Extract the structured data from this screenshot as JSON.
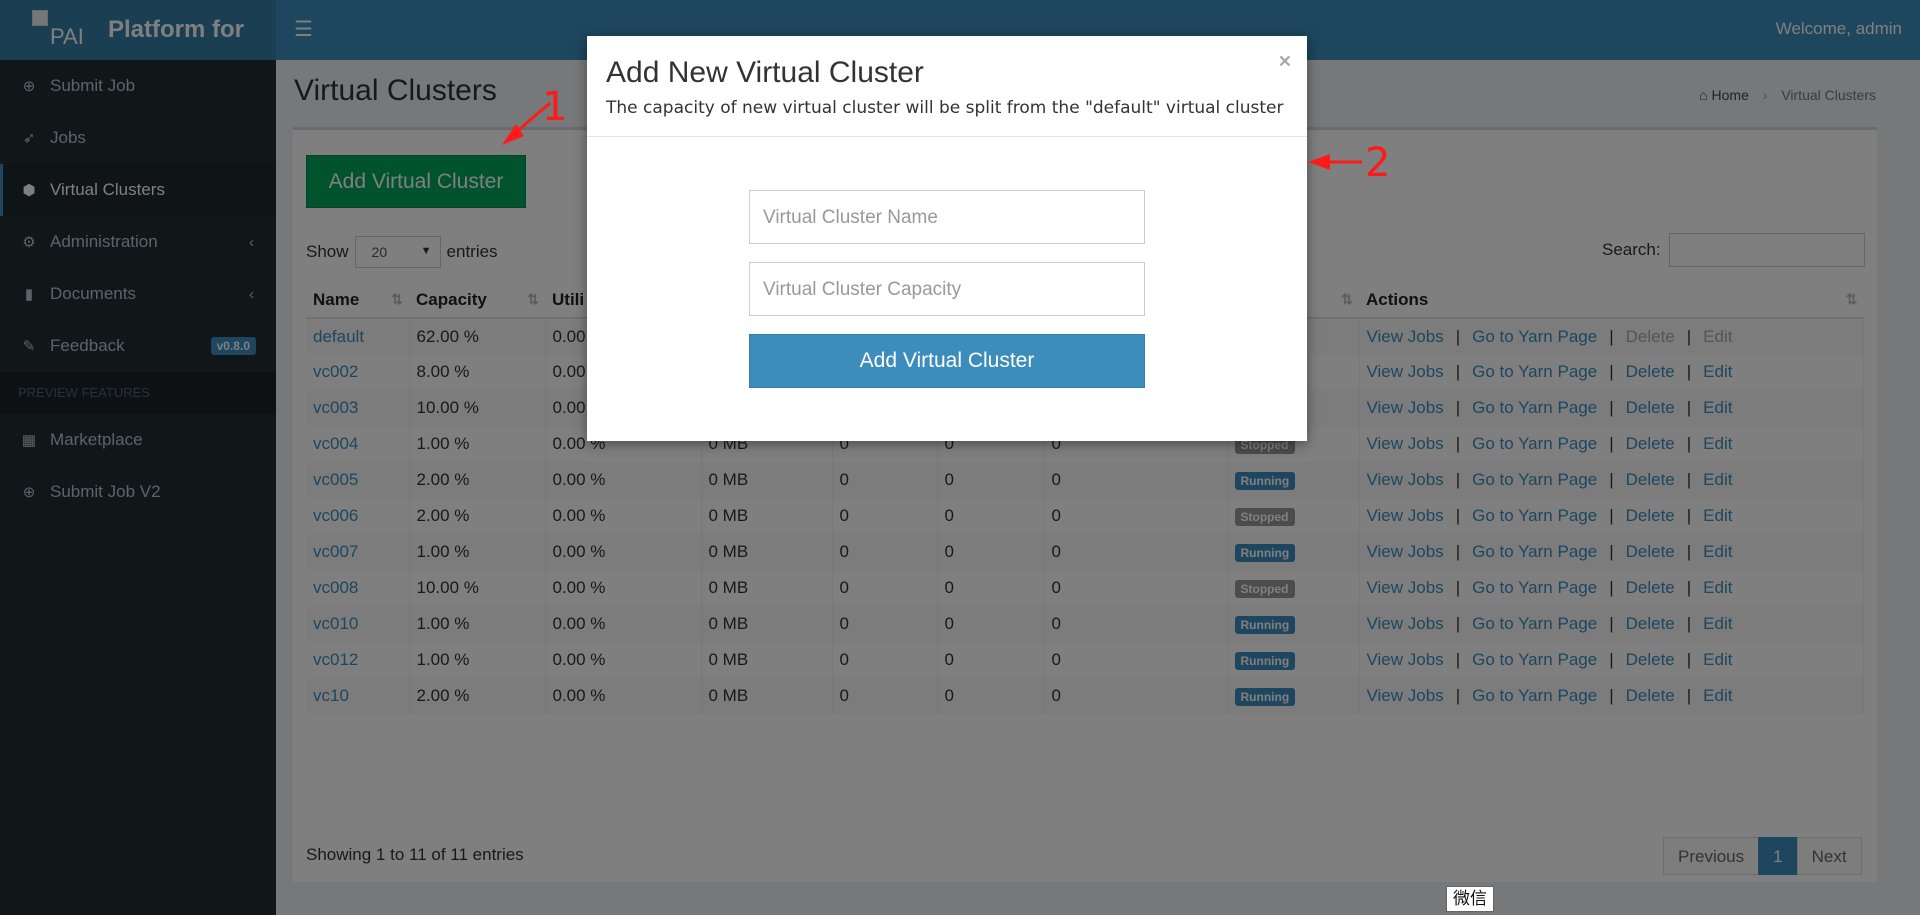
{
  "app": {
    "logo_alt": "PAI",
    "logo_title": "Platform for",
    "welcome": "Welcome, admin"
  },
  "sidebar": {
    "items": [
      {
        "label": "Submit Job",
        "icon": "plus-circle-icon"
      },
      {
        "label": "Jobs",
        "icon": "rocket-icon"
      },
      {
        "label": "Virtual Clusters",
        "icon": "cubes-icon",
        "active": true
      },
      {
        "label": "Administration",
        "icon": "gears-icon"
      },
      {
        "label": "Documents",
        "icon": "book-icon"
      },
      {
        "label": "Feedback",
        "icon": "comments-icon",
        "badge": "v0.8.0"
      }
    ],
    "section_header": "PREVIEW FEATURES",
    "preview_items": [
      {
        "label": "Marketplace",
        "icon": "grid-icon"
      },
      {
        "label": "Submit Job V2",
        "icon": "plus-circle-icon"
      }
    ]
  },
  "page": {
    "title": "Virtual Clusters",
    "breadcrumb": {
      "home": "Home",
      "current": "Virtual Clusters"
    }
  },
  "toolbar": {
    "add_label": "Add Virtual Cluster"
  },
  "table_controls": {
    "show_label": "Show",
    "entries_value": "20",
    "entries_label": "entries",
    "search_label": "Search:"
  },
  "table": {
    "headers": {
      "name": "Name",
      "capacity": "Capacity",
      "utilization": "Utili",
      "actions": "Actions"
    },
    "action_labels": {
      "view_jobs": "View Jobs",
      "yarn": "Go to Yarn Page",
      "delete": "Delete",
      "edit": "Edit"
    },
    "rows": [
      {
        "name": "default",
        "capacity": "62.00 %",
        "used": "0.00",
        "mem": "",
        "c1": "",
        "c2": "",
        "c3": "",
        "status": "",
        "delete_disabled": true
      },
      {
        "name": "vc002",
        "capacity": "8.00 %",
        "used": "0.00",
        "mem": "",
        "c1": "",
        "c2": "",
        "c3": "",
        "status": ""
      },
      {
        "name": "vc003",
        "capacity": "10.00 %",
        "used": "0.00",
        "mem": "",
        "c1": "",
        "c2": "",
        "c3": "",
        "status": ""
      },
      {
        "name": "vc004",
        "capacity": "1.00 %",
        "used": "0.00 %",
        "mem": "0 MB",
        "c1": "0",
        "c2": "0",
        "c3": "0",
        "status": "Stopped"
      },
      {
        "name": "vc005",
        "capacity": "2.00 %",
        "used": "0.00 %",
        "mem": "0 MB",
        "c1": "0",
        "c2": "0",
        "c3": "0",
        "status": "Running"
      },
      {
        "name": "vc006",
        "capacity": "2.00 %",
        "used": "0.00 %",
        "mem": "0 MB",
        "c1": "0",
        "c2": "0",
        "c3": "0",
        "status": "Stopped"
      },
      {
        "name": "vc007",
        "capacity": "1.00 %",
        "used": "0.00 %",
        "mem": "0 MB",
        "c1": "0",
        "c2": "0",
        "c3": "0",
        "status": "Running"
      },
      {
        "name": "vc008",
        "capacity": "10.00 %",
        "used": "0.00 %",
        "mem": "0 MB",
        "c1": "0",
        "c2": "0",
        "c3": "0",
        "status": "Stopped"
      },
      {
        "name": "vc010",
        "capacity": "1.00 %",
        "used": "0.00 %",
        "mem": "0 MB",
        "c1": "0",
        "c2": "0",
        "c3": "0",
        "status": "Running"
      },
      {
        "name": "vc012",
        "capacity": "1.00 %",
        "used": "0.00 %",
        "mem": "0 MB",
        "c1": "0",
        "c2": "0",
        "c3": "0",
        "status": "Running"
      },
      {
        "name": "vc10",
        "capacity": "2.00 %",
        "used": "0.00 %",
        "mem": "0 MB",
        "c1": "0",
        "c2": "0",
        "c3": "0",
        "status": "Running"
      }
    ]
  },
  "footer": {
    "info": "Showing 1 to 11 of 11 entries",
    "previous": "Previous",
    "page": "1",
    "next": "Next"
  },
  "modal": {
    "title": "Add New Virtual Cluster",
    "subtitle": "The capacity of new virtual cluster will be split from the \"default\" virtual cluster",
    "close": "×",
    "name_placeholder": "Virtual Cluster Name",
    "capacity_placeholder": "Virtual Cluster Capacity",
    "submit": "Add Virtual Cluster"
  },
  "annotations": {
    "one": "1",
    "two": "2",
    "arrow_color": "#ff1a1a"
  },
  "tooltip": "微信",
  "colors": {
    "primary": "#3c8dbc",
    "success": "#00a65a",
    "sidebar": "#222d32",
    "running": "#3c8dbc",
    "stopped": "#999999"
  }
}
